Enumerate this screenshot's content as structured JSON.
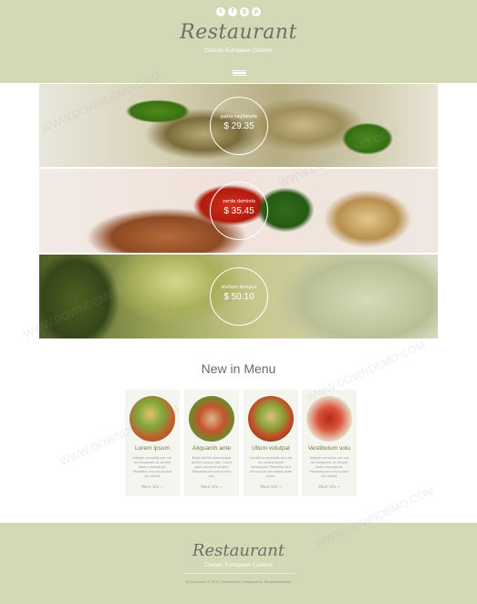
{
  "header": {
    "social_icons": [
      {
        "name": "twitter-icon",
        "glyph": "t"
      },
      {
        "name": "facebook-icon",
        "glyph": "f"
      },
      {
        "name": "google-plus-icon",
        "glyph": "g"
      },
      {
        "name": "pinterest-icon",
        "glyph": "p"
      }
    ],
    "logo": "Restaurant",
    "tagline": "Classic European Cuisine"
  },
  "banners": [
    {
      "name": "pasta tagliatelle",
      "price": "$ 29.35"
    },
    {
      "name": "verde dominio",
      "price": "$ 35.45"
    },
    {
      "name": "stellum tempus",
      "price": "$ 50.10"
    }
  ],
  "menu_section": {
    "title": "New in Menu",
    "cards": [
      {
        "title": "Lorem ipsum",
        "text": "Integer convallis orci vel mi nelaoreet, at ornare lorem consequat. Phasellus era nisl auctor vel veliad.",
        "more": "More info"
      },
      {
        "title": "Aliquamh ante",
        "text": "Nulla facilisi ellentesque sollicit cursus nibh. Fusce eget convallis ornare. Phasellus era nisl auctor veli.",
        "more": "More info"
      },
      {
        "title": "Ullum volutpat",
        "text": "Curabitur convallis orci vel mi ornare lorem consequat. Phasellus era nisl auctor vel veliad pede tuam.",
        "more": "More info"
      },
      {
        "title": "Vestibulum volu",
        "text": "Integer convallis orci vel mi nelaoreet, at ornare lorem consequat. Phasellus era nisl auctor vel veliad.",
        "more": "More info"
      }
    ]
  },
  "footer": {
    "logo": "Restaurant",
    "tagline": "Classic European Cuisine",
    "copyright": "All Copyright © 2014 | Restaurant | Designed by TemplateMonster"
  },
  "watermark": "WWW.DOWNDEMO.COM",
  "colors": {
    "header_bg": "#d5d8b7",
    "accent": "#6f7f3f"
  }
}
